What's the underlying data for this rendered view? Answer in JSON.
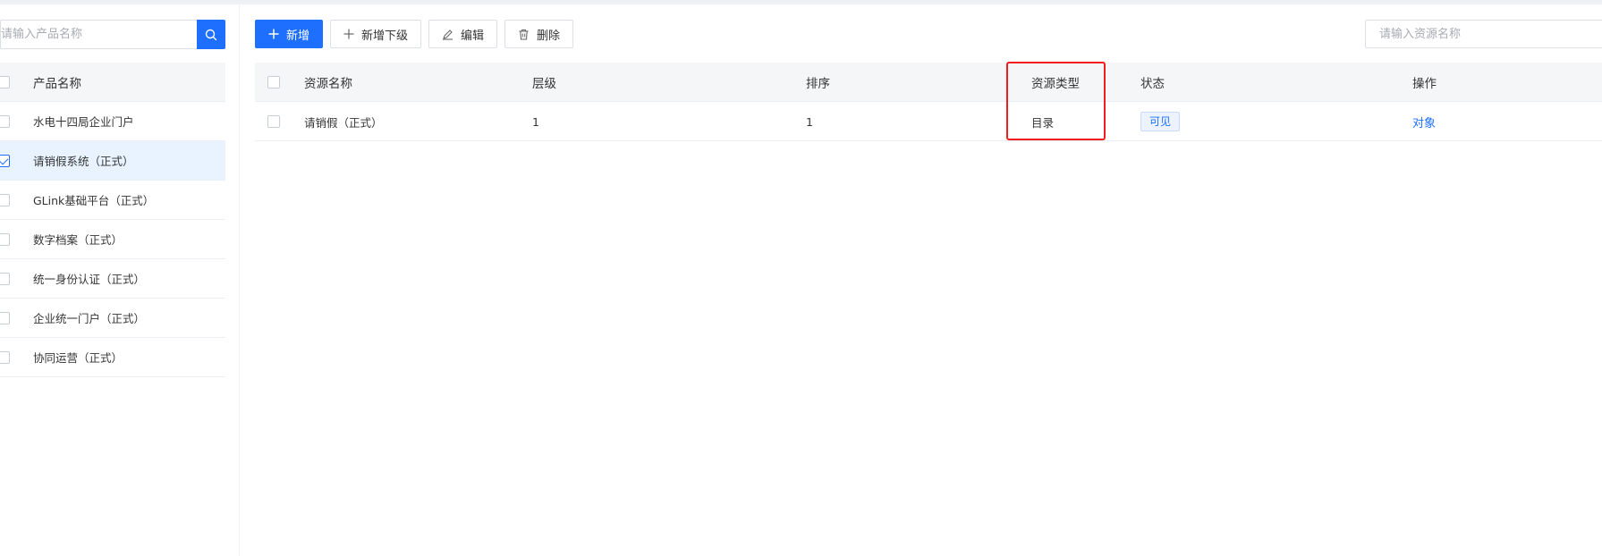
{
  "left_panel": {
    "search_placeholder": "请输入产品名称",
    "header": "产品名称",
    "items": [
      {
        "label": "水电十四局企业门户",
        "checked": false
      },
      {
        "label": "请销假系统（正式）",
        "checked": true
      },
      {
        "label": "GLink基础平台（正式）",
        "checked": false
      },
      {
        "label": "数字档案（正式）",
        "checked": false
      },
      {
        "label": "统一身份认证（正式）",
        "checked": false
      },
      {
        "label": "企业统一门户（正式）",
        "checked": false
      },
      {
        "label": "协同运营（正式）",
        "checked": false
      }
    ]
  },
  "toolbar": {
    "add_label": "新增",
    "add_child_label": "新增下级",
    "edit_label": "编辑",
    "delete_label": "删除"
  },
  "right_search": {
    "placeholder": "请输入资源名称"
  },
  "table": {
    "columns": {
      "name": "资源名称",
      "level": "层级",
      "order": "排序",
      "type": "资源类型",
      "status": "状态",
      "action": "操作"
    },
    "rows": [
      {
        "name": "请销假（正式）",
        "level": "1",
        "order": "1",
        "type": "目录",
        "status": "可见",
        "action": "对象"
      }
    ]
  },
  "colors": {
    "primary": "#1f6fff",
    "highlight": "#f01d1d",
    "selected_row": "#e8f3ff"
  }
}
